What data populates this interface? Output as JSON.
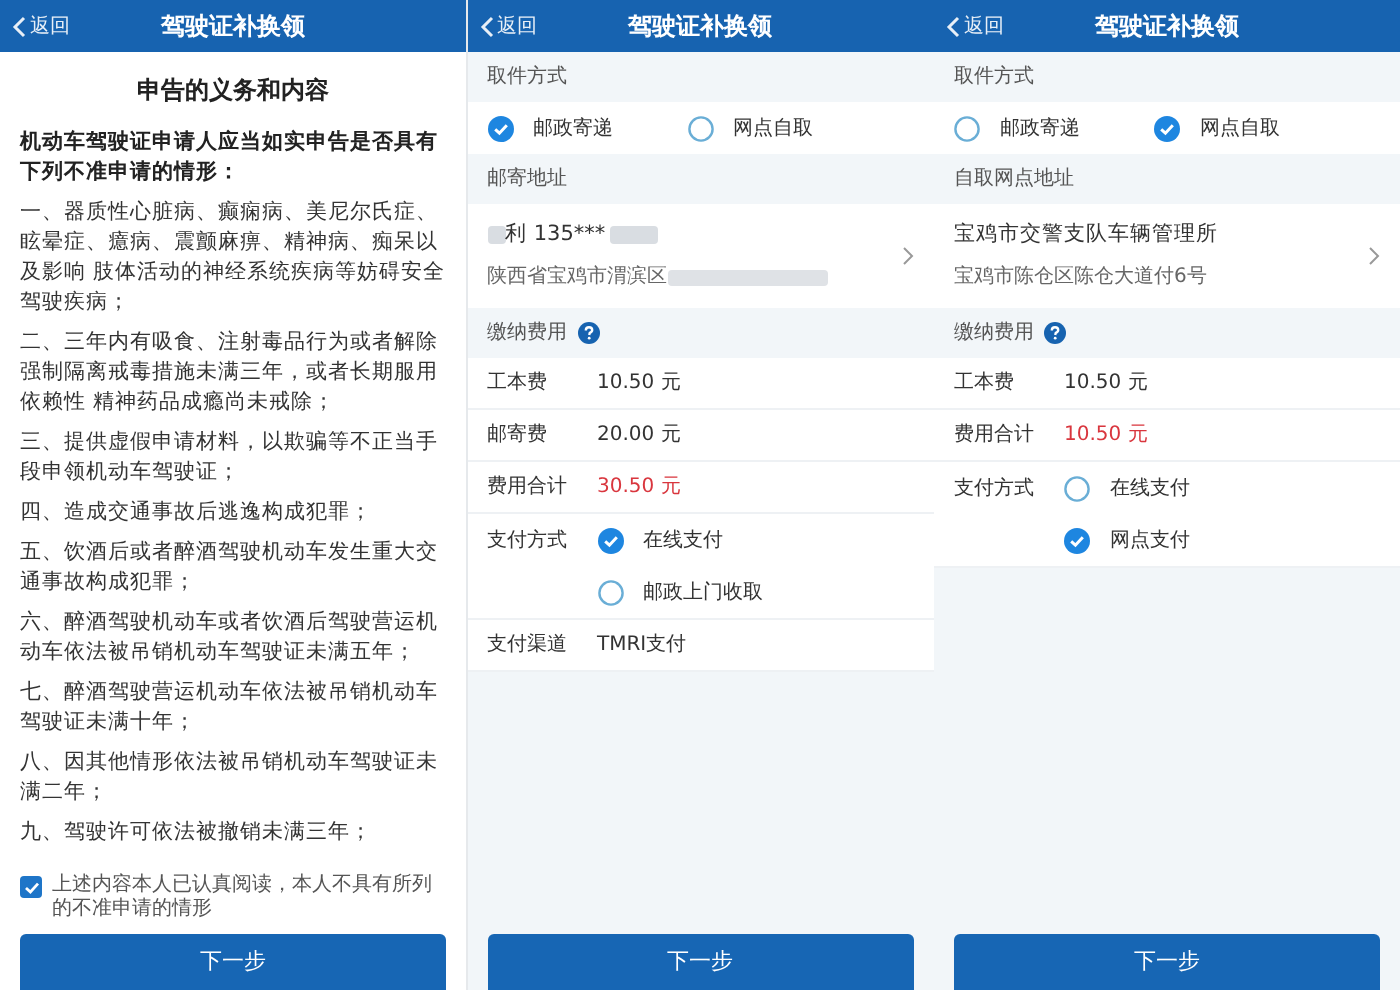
{
  "screens": [
    {
      "kind": "declaration",
      "header": {
        "back": "返回",
        "title": "驾驶证补换领"
      },
      "heading": "申告的义务和内容",
      "intro": "机动车驾驶证申请人应当如实申告是否具有下列不准申请的情形：",
      "items": [
        "一、器质性心脏病、癫痫病、美尼尔氏症、眩晕症、癔病、震颤麻痹、精神病、痴呆以及影响 肢体活动的神经系统疾病等妨碍安全驾驶疾病；",
        "二、三年内有吸食、注射毒品行为或者解除强制隔离戒毒措施未满三年，或者长期服用依赖性 精神药品成瘾尚未戒除；",
        "三、提供虚假申请材料，以欺骗等不正当手段申领机动车驾驶证；",
        "四、造成交通事故后逃逸构成犯罪；",
        "五、饮酒后或者醉酒驾驶机动车发生重大交通事故构成犯罪；",
        "六、醉酒驾驶机动车或者饮酒后驾驶营运机动车依法被吊销机动车驾驶证未满五年；",
        "七、醉酒驾驶营运机动车依法被吊销机动车驾驶证未满十年；",
        "八、因其他情形依法被吊销机动车驾驶证未满二年；",
        "九、驾驶许可依法被撤销未满三年；"
      ],
      "agreement": {
        "text": "上述内容本人已认真阅读，本人不具有所列的不准申请的情形",
        "checked": true
      },
      "button": "下一步"
    },
    {
      "kind": "form",
      "header": {
        "back": "返回",
        "title": "驾驶证补换领"
      },
      "rows": [
        {
          "kind": "section",
          "label": "取件方式"
        },
        {
          "kind": "radio_group",
          "options": [
            {
              "label": "邮政寄递",
              "selected": true
            },
            {
              "label": "网点自取",
              "selected": false
            }
          ]
        },
        {
          "kind": "section",
          "label": "邮寄地址"
        },
        {
          "kind": "address",
          "line1": "利 135***",
          "line2": "陕西省宝鸡市渭滨区",
          "redacted": true
        },
        {
          "kind": "section",
          "label": "缴纳费用",
          "help": true
        },
        {
          "kind": "field",
          "label": "工本费",
          "value": "10.50 元",
          "highlight": false
        },
        {
          "kind": "field",
          "label": "邮寄费",
          "value": "20.00 元",
          "highlight": false
        },
        {
          "kind": "field",
          "label": "费用合计",
          "value": "30.50 元",
          "highlight": true
        },
        {
          "kind": "radio_field",
          "label": "支付方式",
          "options": [
            {
              "label": "在线支付",
              "selected": true
            },
            {
              "label": "邮政上门收取",
              "selected": false
            }
          ]
        },
        {
          "kind": "field",
          "label": "支付渠道",
          "value": "TMRI支付",
          "highlight": false
        }
      ],
      "button": "下一步"
    },
    {
      "kind": "form",
      "header": {
        "back": "返回",
        "title": "驾驶证补换领"
      },
      "rows": [
        {
          "kind": "section",
          "label": "取件方式"
        },
        {
          "kind": "radio_group",
          "options": [
            {
              "label": "邮政寄递",
              "selected": false
            },
            {
              "label": "网点自取",
              "selected": true
            }
          ]
        },
        {
          "kind": "section",
          "label": "自取网点地址"
        },
        {
          "kind": "address",
          "line1": "宝鸡市交警支队车辆管理所",
          "line2": "宝鸡市陈仓区陈仓大道付6号",
          "redacted": false
        },
        {
          "kind": "section",
          "label": "缴纳费用",
          "help": true
        },
        {
          "kind": "field",
          "label": "工本费",
          "value": "10.50 元",
          "highlight": false
        },
        {
          "kind": "field",
          "label": "费用合计",
          "value": "10.50 元",
          "highlight": true
        },
        {
          "kind": "radio_field",
          "label": "支付方式",
          "options": [
            {
              "label": "在线支付",
              "selected": false
            },
            {
              "label": "网点支付",
              "selected": true
            }
          ]
        }
      ],
      "button": "下一步"
    }
  ]
}
